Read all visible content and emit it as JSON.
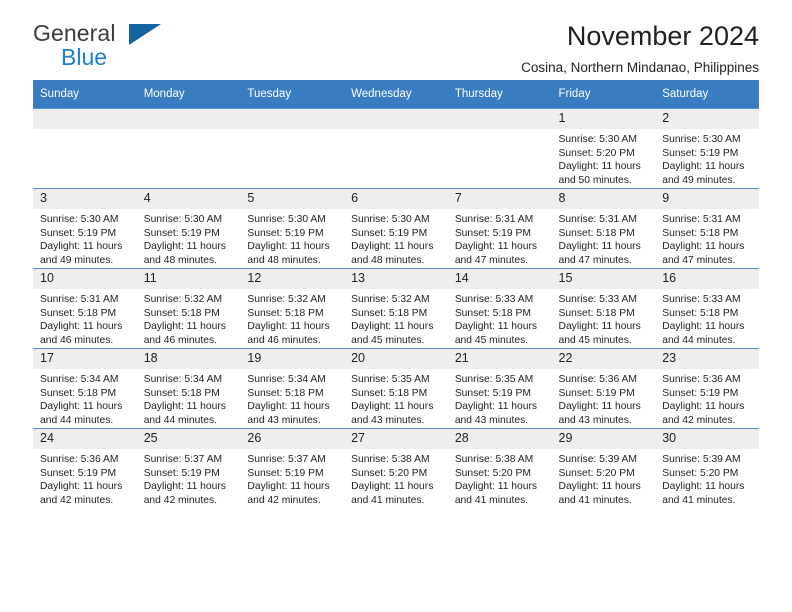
{
  "brand": {
    "name_top": "General",
    "name_bottom": "Blue",
    "flag_icon": "blue-triangle-flag",
    "accent_color": "#1c7fd1"
  },
  "header": {
    "title": "November 2024",
    "subtitle": "Cosina, Northern Mindanao, Philippines"
  },
  "theme": {
    "header_bg": "#3a7cc0",
    "daynum_bg": "#eeeeee",
    "grid_line": "#5a93cd",
    "text": "#231f20"
  },
  "weekday_headers": [
    "Sunday",
    "Monday",
    "Tuesday",
    "Wednesday",
    "Thursday",
    "Friday",
    "Saturday"
  ],
  "labels": {
    "sunrise": "Sunrise:",
    "sunset": "Sunset:",
    "daylight": "Daylight:"
  },
  "weeks": [
    [
      {
        "day": "",
        "empty": true
      },
      {
        "day": "",
        "empty": true
      },
      {
        "day": "",
        "empty": true
      },
      {
        "day": "",
        "empty": true
      },
      {
        "day": "",
        "empty": true
      },
      {
        "day": "1",
        "sunrise": "Sunrise: 5:30 AM",
        "sunset": "Sunset: 5:20 PM",
        "daylight": "Daylight: 11 hours and 50 minutes."
      },
      {
        "day": "2",
        "sunrise": "Sunrise: 5:30 AM",
        "sunset": "Sunset: 5:19 PM",
        "daylight": "Daylight: 11 hours and 49 minutes."
      }
    ],
    [
      {
        "day": "3",
        "sunrise": "Sunrise: 5:30 AM",
        "sunset": "Sunset: 5:19 PM",
        "daylight": "Daylight: 11 hours and 49 minutes."
      },
      {
        "day": "4",
        "sunrise": "Sunrise: 5:30 AM",
        "sunset": "Sunset: 5:19 PM",
        "daylight": "Daylight: 11 hours and 48 minutes."
      },
      {
        "day": "5",
        "sunrise": "Sunrise: 5:30 AM",
        "sunset": "Sunset: 5:19 PM",
        "daylight": "Daylight: 11 hours and 48 minutes."
      },
      {
        "day": "6",
        "sunrise": "Sunrise: 5:30 AM",
        "sunset": "Sunset: 5:19 PM",
        "daylight": "Daylight: 11 hours and 48 minutes."
      },
      {
        "day": "7",
        "sunrise": "Sunrise: 5:31 AM",
        "sunset": "Sunset: 5:19 PM",
        "daylight": "Daylight: 11 hours and 47 minutes."
      },
      {
        "day": "8",
        "sunrise": "Sunrise: 5:31 AM",
        "sunset": "Sunset: 5:18 PM",
        "daylight": "Daylight: 11 hours and 47 minutes."
      },
      {
        "day": "9",
        "sunrise": "Sunrise: 5:31 AM",
        "sunset": "Sunset: 5:18 PM",
        "daylight": "Daylight: 11 hours and 47 minutes."
      }
    ],
    [
      {
        "day": "10",
        "sunrise": "Sunrise: 5:31 AM",
        "sunset": "Sunset: 5:18 PM",
        "daylight": "Daylight: 11 hours and 46 minutes."
      },
      {
        "day": "11",
        "sunrise": "Sunrise: 5:32 AM",
        "sunset": "Sunset: 5:18 PM",
        "daylight": "Daylight: 11 hours and 46 minutes."
      },
      {
        "day": "12",
        "sunrise": "Sunrise: 5:32 AM",
        "sunset": "Sunset: 5:18 PM",
        "daylight": "Daylight: 11 hours and 46 minutes."
      },
      {
        "day": "13",
        "sunrise": "Sunrise: 5:32 AM",
        "sunset": "Sunset: 5:18 PM",
        "daylight": "Daylight: 11 hours and 45 minutes."
      },
      {
        "day": "14",
        "sunrise": "Sunrise: 5:33 AM",
        "sunset": "Sunset: 5:18 PM",
        "daylight": "Daylight: 11 hours and 45 minutes."
      },
      {
        "day": "15",
        "sunrise": "Sunrise: 5:33 AM",
        "sunset": "Sunset: 5:18 PM",
        "daylight": "Daylight: 11 hours and 45 minutes."
      },
      {
        "day": "16",
        "sunrise": "Sunrise: 5:33 AM",
        "sunset": "Sunset: 5:18 PM",
        "daylight": "Daylight: 11 hours and 44 minutes."
      }
    ],
    [
      {
        "day": "17",
        "sunrise": "Sunrise: 5:34 AM",
        "sunset": "Sunset: 5:18 PM",
        "daylight": "Daylight: 11 hours and 44 minutes."
      },
      {
        "day": "18",
        "sunrise": "Sunrise: 5:34 AM",
        "sunset": "Sunset: 5:18 PM",
        "daylight": "Daylight: 11 hours and 44 minutes."
      },
      {
        "day": "19",
        "sunrise": "Sunrise: 5:34 AM",
        "sunset": "Sunset: 5:18 PM",
        "daylight": "Daylight: 11 hours and 43 minutes."
      },
      {
        "day": "20",
        "sunrise": "Sunrise: 5:35 AM",
        "sunset": "Sunset: 5:18 PM",
        "daylight": "Daylight: 11 hours and 43 minutes."
      },
      {
        "day": "21",
        "sunrise": "Sunrise: 5:35 AM",
        "sunset": "Sunset: 5:19 PM",
        "daylight": "Daylight: 11 hours and 43 minutes."
      },
      {
        "day": "22",
        "sunrise": "Sunrise: 5:36 AM",
        "sunset": "Sunset: 5:19 PM",
        "daylight": "Daylight: 11 hours and 43 minutes."
      },
      {
        "day": "23",
        "sunrise": "Sunrise: 5:36 AM",
        "sunset": "Sunset: 5:19 PM",
        "daylight": "Daylight: 11 hours and 42 minutes."
      }
    ],
    [
      {
        "day": "24",
        "sunrise": "Sunrise: 5:36 AM",
        "sunset": "Sunset: 5:19 PM",
        "daylight": "Daylight: 11 hours and 42 minutes."
      },
      {
        "day": "25",
        "sunrise": "Sunrise: 5:37 AM",
        "sunset": "Sunset: 5:19 PM",
        "daylight": "Daylight: 11 hours and 42 minutes."
      },
      {
        "day": "26",
        "sunrise": "Sunrise: 5:37 AM",
        "sunset": "Sunset: 5:19 PM",
        "daylight": "Daylight: 11 hours and 42 minutes."
      },
      {
        "day": "27",
        "sunrise": "Sunrise: 5:38 AM",
        "sunset": "Sunset: 5:20 PM",
        "daylight": "Daylight: 11 hours and 41 minutes."
      },
      {
        "day": "28",
        "sunrise": "Sunrise: 5:38 AM",
        "sunset": "Sunset: 5:20 PM",
        "daylight": "Daylight: 11 hours and 41 minutes."
      },
      {
        "day": "29",
        "sunrise": "Sunrise: 5:39 AM",
        "sunset": "Sunset: 5:20 PM",
        "daylight": "Daylight: 11 hours and 41 minutes."
      },
      {
        "day": "30",
        "sunrise": "Sunrise: 5:39 AM",
        "sunset": "Sunset: 5:20 PM",
        "daylight": "Daylight: 11 hours and 41 minutes."
      }
    ]
  ]
}
